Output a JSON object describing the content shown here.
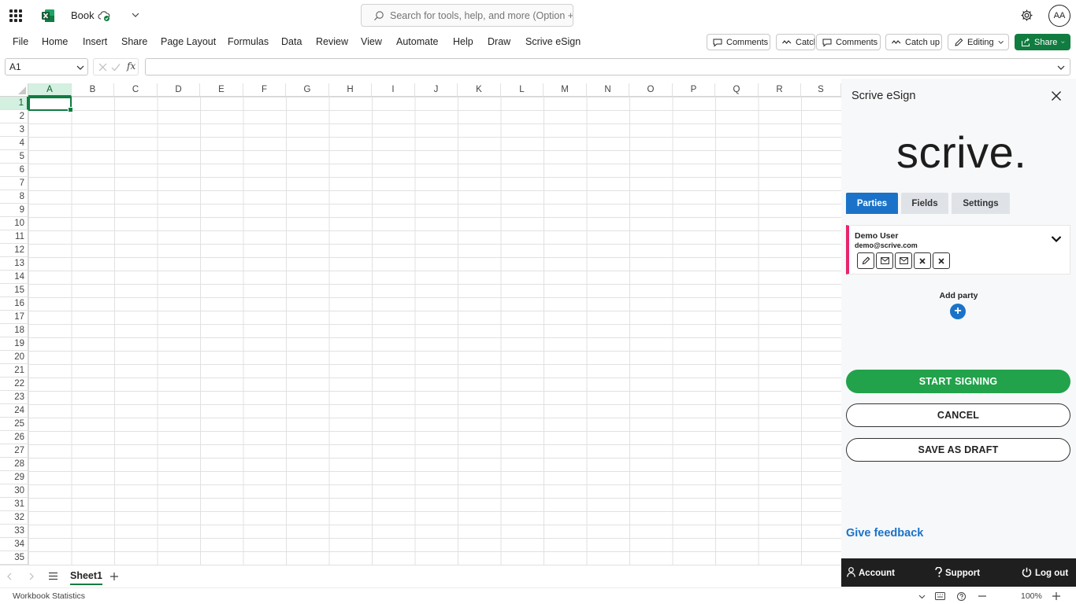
{
  "titlebar": {
    "app_icon": "excel-logo",
    "book_title": "Book",
    "search_placeholder": "Search for tools, help, and more (Option + Q)",
    "avatar_initials": "AA"
  },
  "ribbon": {
    "tabs": [
      "File",
      "Home",
      "Insert",
      "Share",
      "Page Layout",
      "Formulas",
      "Data",
      "Review",
      "View",
      "Automate",
      "Help",
      "Draw",
      "Scrive eSign"
    ],
    "buttons": {
      "comments_1": "Comments",
      "catchup_1": "Catch",
      "comments_2": "Comments",
      "catchup_2": "Catch up",
      "editing": "Editing",
      "share": "Share"
    }
  },
  "formula_bar": {
    "name_box": "A1",
    "fx_label": "fx"
  },
  "grid": {
    "columns": [
      "A",
      "B",
      "C",
      "D",
      "E",
      "F",
      "G",
      "H",
      "I",
      "J",
      "K",
      "L",
      "M",
      "N",
      "O",
      "P",
      "Q",
      "R",
      "S"
    ],
    "rows": [
      "1",
      "2",
      "3",
      "4",
      "5",
      "6",
      "7",
      "8",
      "9",
      "10",
      "11",
      "12",
      "13",
      "14",
      "15",
      "16",
      "17",
      "18",
      "19",
      "20",
      "21",
      "22",
      "23",
      "24",
      "25",
      "26",
      "27",
      "28",
      "29",
      "30",
      "31",
      "32",
      "33",
      "34",
      "35"
    ],
    "selected_column": "A",
    "selected_row": "1"
  },
  "sheets": {
    "active": "Sheet1"
  },
  "status": {
    "left": "Workbook Statistics",
    "zoom": "100%"
  },
  "panel": {
    "title": "Scrive eSign",
    "logo_text": "scrive.",
    "tabs": [
      "Parties",
      "Fields",
      "Settings"
    ],
    "active_tab": "Parties",
    "party": {
      "name": "Demo User",
      "email": "demo@scrive.com"
    },
    "add_party_label": "Add party",
    "start_signing": "START SIGNING",
    "cancel": "CANCEL",
    "save_draft": "SAVE AS DRAFT",
    "feedback": "Give feedback",
    "footer": {
      "account": "Account",
      "support": "Support",
      "logout": "Log out"
    },
    "accent_color": "#1a73c8",
    "start_color": "#22a24a",
    "party_color": "#e8246a"
  }
}
